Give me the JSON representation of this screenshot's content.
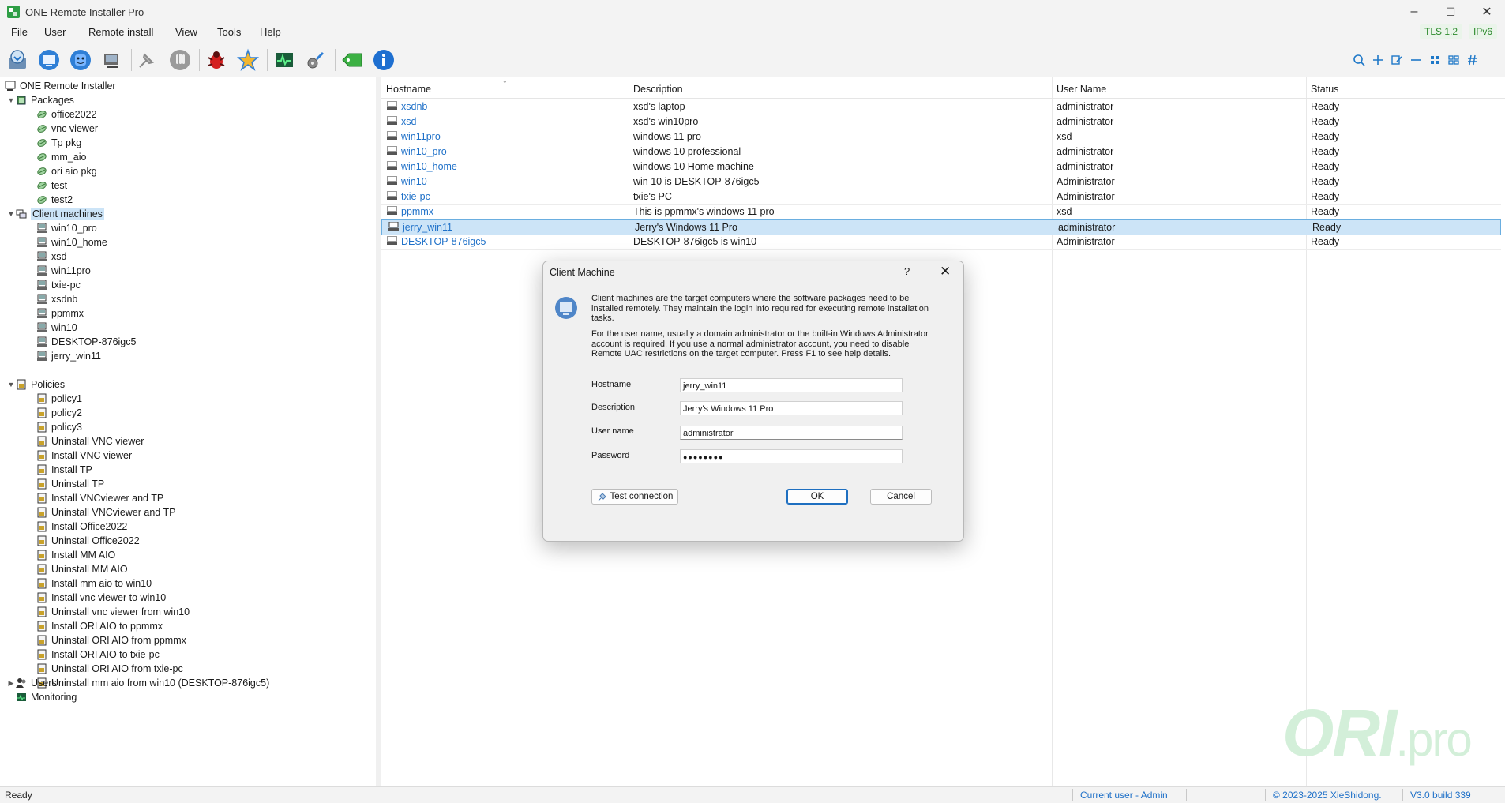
{
  "window": {
    "title": "ONE Remote Installer Pro",
    "controls": {
      "minimize": "–",
      "maximize": "☐",
      "close": "✕"
    }
  },
  "menu": [
    "File",
    "User",
    "Remote install",
    "View",
    "Tools",
    "Help"
  ],
  "badges": {
    "tls": "TLS 1.2",
    "ipv6": "IPv6"
  },
  "toolbar_icons": [
    "install-icon",
    "remote-desktop-icon",
    "finder-icon",
    "computer-icon",
    "pin-icon",
    "stop-hand-icon",
    "bug-icon",
    "star-icon",
    "monitor-icon",
    "settings-icon",
    "tag-icon",
    "info-icon"
  ],
  "right_toolbar_icons": [
    "search-icon",
    "add-icon",
    "edit-icon",
    "remove-icon",
    "grid-icon",
    "tiles-icon",
    "hash-icon"
  ],
  "tree": {
    "root": "ONE Remote Installer",
    "packages_label": "Packages",
    "packages": [
      "office2022",
      "vnc viewer",
      "Tp pkg",
      "mm_aio",
      "ori aio pkg",
      "test",
      "test2"
    ],
    "clients_label": "Client machines",
    "clients": [
      "win10_pro",
      "win10_home",
      "xsd",
      "win11pro",
      "txie-pc",
      "xsdnb",
      "ppmmx",
      "win10",
      "DESKTOP-876igc5",
      "jerry_win11"
    ],
    "policies_label": "Policies",
    "policies": [
      "policy1",
      "policy2",
      "policy3",
      "Uninstall VNC viewer",
      "Install VNC viewer",
      "Install TP",
      "Uninstall TP",
      "Install VNCviewer and TP",
      "Uninstall VNCviewer and TP",
      "Install Office2022",
      "Uninstall Office2022",
      "Install MM AIO",
      "Uninstall MM AIO",
      "Install mm aio to win10",
      "Install vnc viewer to win10",
      "Uninstall vnc viewer from win10",
      "Install ORI AIO to ppmmx",
      "Uninstall ORI AIO from ppmmx",
      "Install ORI AIO to txie-pc",
      "Uninstall ORI AIO from txie-pc",
      "Uninstall mm aio from win10 (DESKTOP-876igc5)"
    ],
    "users_label": "Users",
    "monitoring_label": "Monitoring"
  },
  "list": {
    "columns": [
      "Hostname",
      "Description",
      "User Name",
      "Status"
    ],
    "rows": [
      {
        "hostname": "xsdnb",
        "description": "xsd's laptop",
        "user": "administrator",
        "status": "Ready"
      },
      {
        "hostname": "xsd",
        "description": "xsd's win10pro",
        "user": "administrator",
        "status": "Ready"
      },
      {
        "hostname": "win11pro",
        "description": "windows 11 pro",
        "user": "xsd",
        "status": "Ready"
      },
      {
        "hostname": "win10_pro",
        "description": "windows 10 professional",
        "user": "administrator",
        "status": "Ready"
      },
      {
        "hostname": "win10_home",
        "description": "windows 10 Home machine",
        "user": "administrator",
        "status": "Ready"
      },
      {
        "hostname": "win10",
        "description": "win 10 is DESKTOP-876igc5",
        "user": "Administrator",
        "status": "Ready"
      },
      {
        "hostname": "txie-pc",
        "description": "txie's PC",
        "user": "Administrator",
        "status": "Ready"
      },
      {
        "hostname": "ppmmx",
        "description": "This is ppmmx's windows 11 pro",
        "user": "xsd",
        "status": "Ready"
      },
      {
        "hostname": "jerry_win11",
        "description": "Jerry's Windows 11 Pro",
        "user": "administrator",
        "status": "Ready"
      },
      {
        "hostname": "DESKTOP-876igc5",
        "description": "DESKTOP-876igc5 is win10",
        "user": "Administrator",
        "status": "Ready"
      }
    ]
  },
  "dialog": {
    "title": "Client Machine",
    "help": "?",
    "close": "✕",
    "intro": "Client machines are the target computers where the software packages need to be installed remotely. They maintain the login info required for executing remote installation tasks.",
    "note": "For the user name, usually a domain administrator or the built-in Windows Administrator account is required. If you use a normal administrator account, you need to disable Remote UAC restrictions on the target computer. Press F1 to see help details.",
    "fields": {
      "hostname_label": "Hostname",
      "hostname_value": "jerry_win11",
      "description_label": "Description",
      "description_value": "Jerry's Windows 11 Pro",
      "username_label": "User name",
      "username_value": "administrator",
      "password_label": "Password",
      "password_value": "●●●●●●●●"
    },
    "test_button": "Test connection",
    "ok_button": "OK",
    "cancel_button": "Cancel"
  },
  "statusbar": {
    "status": "Ready",
    "current_user": "Current user - Admin",
    "copyright": "© 2023-2025 XieShidong.",
    "version": "V3.0 build 339"
  },
  "watermark": {
    "main": "ORI",
    "suffix": ".pro"
  }
}
